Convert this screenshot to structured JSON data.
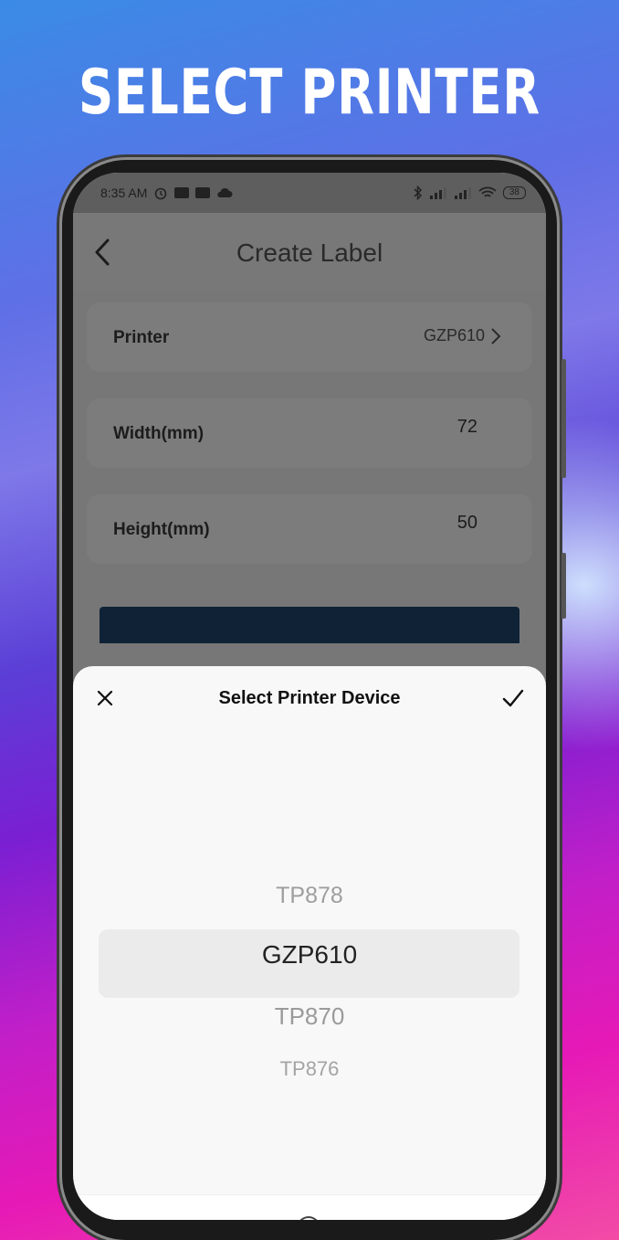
{
  "promo": {
    "title": "SELECT PRINTER"
  },
  "status_bar": {
    "time": "8:35 AM",
    "battery": "38"
  },
  "header": {
    "title": "Create Label"
  },
  "form": {
    "printer": {
      "label": "Printer",
      "value": "GZP610"
    },
    "width": {
      "label": "Width(mm)",
      "value": "72"
    },
    "height": {
      "label": "Height(mm)",
      "value": "50"
    }
  },
  "sheet": {
    "title": "Select Printer Device",
    "options": [
      "TP878",
      "GZP610",
      "TP870",
      "TP876"
    ],
    "selected": "GZP610"
  },
  "colors": {
    "accent_button": "#0f2236",
    "overlay": "#777777",
    "sheet": "#f8f8f8"
  }
}
